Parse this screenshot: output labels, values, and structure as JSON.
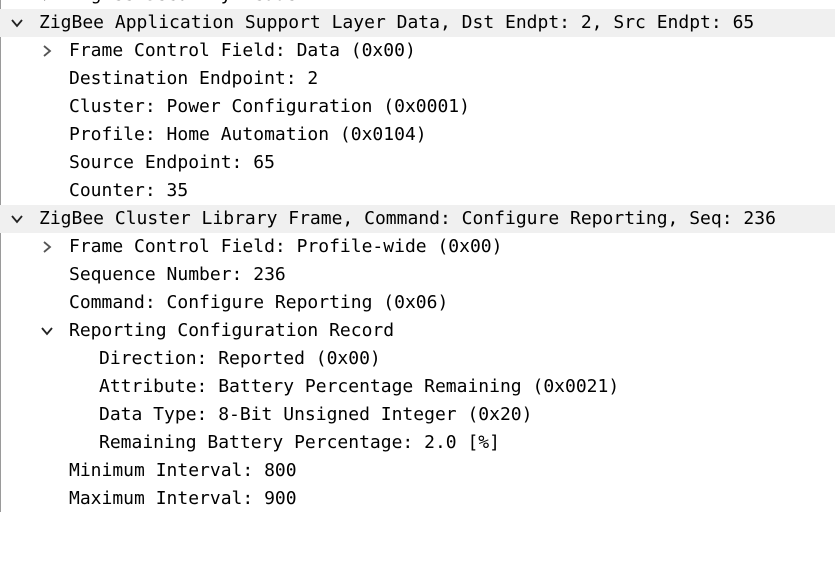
{
  "tree": {
    "rows": [
      {
        "label": "ZigBee Security Header",
        "level": 1,
        "toggle": "collapsed"
      },
      {
        "label": "ZigBee Application Support Layer Data, Dst Endpt: 2, Src Endpt: 65",
        "level": 0,
        "toggle": "expanded",
        "header": true
      },
      {
        "label": "Frame Control Field: Data (0x00)",
        "level": 1,
        "toggle": "collapsed"
      },
      {
        "label": "Destination Endpoint: 2",
        "level": 1,
        "toggle": "none"
      },
      {
        "label": "Cluster: Power Configuration (0x0001)",
        "level": 1,
        "toggle": "none"
      },
      {
        "label": "Profile: Home Automation (0x0104)",
        "level": 1,
        "toggle": "none"
      },
      {
        "label": "Source Endpoint: 65",
        "level": 1,
        "toggle": "none"
      },
      {
        "label": "Counter: 35",
        "level": 1,
        "toggle": "none"
      },
      {
        "label": "ZigBee Cluster Library Frame, Command: Configure Reporting, Seq: 236",
        "level": 0,
        "toggle": "expanded",
        "header": true
      },
      {
        "label": "Frame Control Field: Profile-wide (0x00)",
        "level": 1,
        "toggle": "collapsed"
      },
      {
        "label": "Sequence Number: 236",
        "level": 1,
        "toggle": "none"
      },
      {
        "label": "Command: Configure Reporting (0x06)",
        "level": 1,
        "toggle": "none"
      },
      {
        "label": "Reporting Configuration Record",
        "level": 1,
        "toggle": "expanded"
      },
      {
        "label": "Direction: Reported (0x00)",
        "level": 2,
        "toggle": "none"
      },
      {
        "label": "Attribute: Battery Percentage Remaining (0x0021)",
        "level": 2,
        "toggle": "none"
      },
      {
        "label": "Data Type: 8-Bit Unsigned Integer (0x20)",
        "level": 2,
        "toggle": "none"
      },
      {
        "label": "Remaining Battery Percentage: 2.0 [%]",
        "level": 2,
        "toggle": "none"
      },
      {
        "label": "Minimum Interval: 800",
        "level": 1,
        "toggle": "none"
      },
      {
        "label": "Maximum Interval: 900",
        "level": 1,
        "toggle": "none"
      }
    ]
  }
}
